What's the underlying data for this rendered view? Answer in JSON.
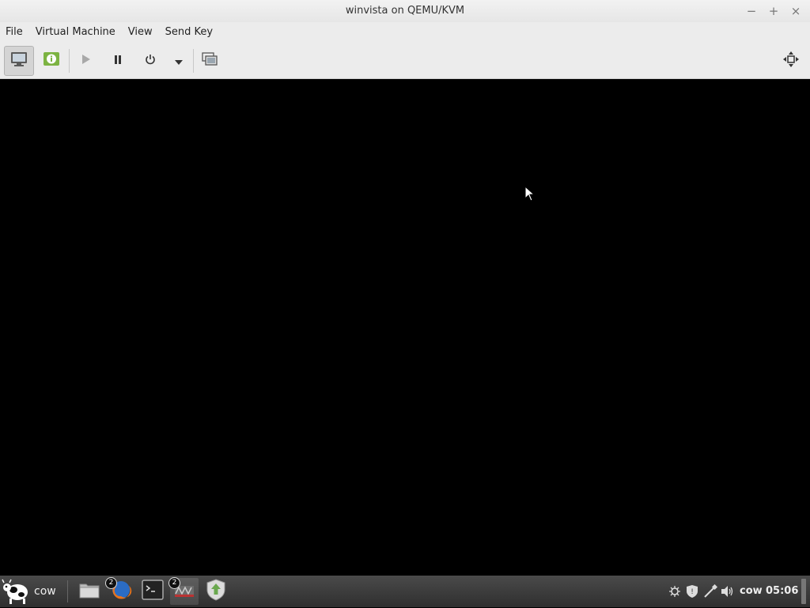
{
  "window": {
    "title": "winvista on QEMU/KVM",
    "controls": {
      "minimize": "−",
      "maximize": "+",
      "close": "×"
    }
  },
  "menu": [
    "File",
    "Virtual Machine",
    "View",
    "Send Key"
  ],
  "toolbar": {
    "icons": [
      "console-icon",
      "details-icon",
      "run-icon",
      "pause-icon",
      "power-icon",
      "dropdown-arrow-icon",
      "snapshots-icon",
      "fullscreen-icon"
    ]
  },
  "taskbar": {
    "menu_label": "cow",
    "launchers": [
      {
        "name": "files-icon"
      },
      {
        "name": "firefox-icon",
        "badge": "2"
      },
      {
        "name": "terminal-icon"
      },
      {
        "name": "virt-manager-icon",
        "badge": "2"
      },
      {
        "name": "update-manager-icon"
      }
    ],
    "user": "cow",
    "clock": "05:06"
  }
}
